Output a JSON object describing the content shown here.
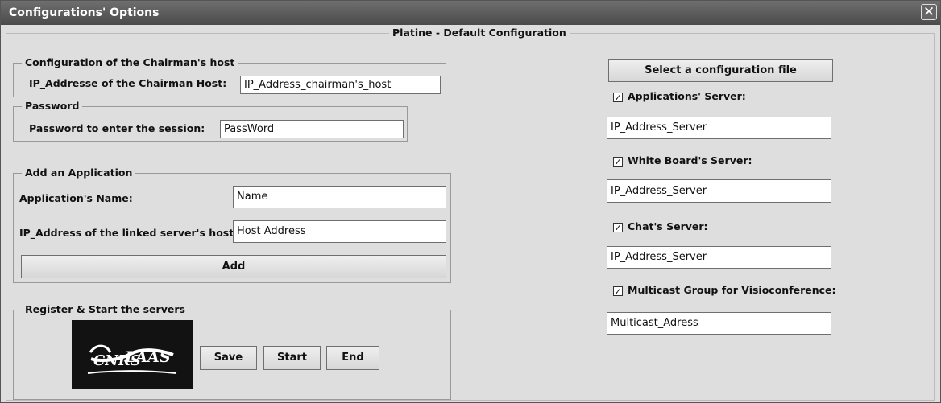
{
  "window": {
    "title": "Configurations' Options",
    "close_glyph": "✕"
  },
  "main_title": "Platine - Default Configuration",
  "chairman": {
    "legend": "Configuration of the Chairman's host",
    "label": "IP_Addresse of the Chairman Host:",
    "value": "IP_Address_chairman's_host"
  },
  "password": {
    "legend": "Password",
    "label": "Password to enter the session:",
    "value": "PassWord"
  },
  "application": {
    "legend": "Add an Application",
    "name_label": "Application's Name:",
    "name_value": "Name",
    "ip_label": "IP_Address of the linked server's host:",
    "ip_value": "Host Address",
    "add_label": "Add"
  },
  "register": {
    "legend": "Register & Start the servers",
    "logo_text": "CNRS-LAAS",
    "save_label": "Save",
    "start_label": "Start",
    "end_label": "End"
  },
  "right": {
    "select_label": "Select a configuration file",
    "servers": [
      {
        "label": "Applications' Server:",
        "value": "IP_Address_Server",
        "checked": true
      },
      {
        "label": "White Board's Server:",
        "value": "IP_Address_Server",
        "checked": true
      },
      {
        "label": "Chat's Server:",
        "value": "IP_Address_Server",
        "checked": true
      },
      {
        "label": "Multicast Group for Visioconference:",
        "value": "Multicast_Adress",
        "checked": true
      }
    ],
    "check_glyph": "✓"
  }
}
